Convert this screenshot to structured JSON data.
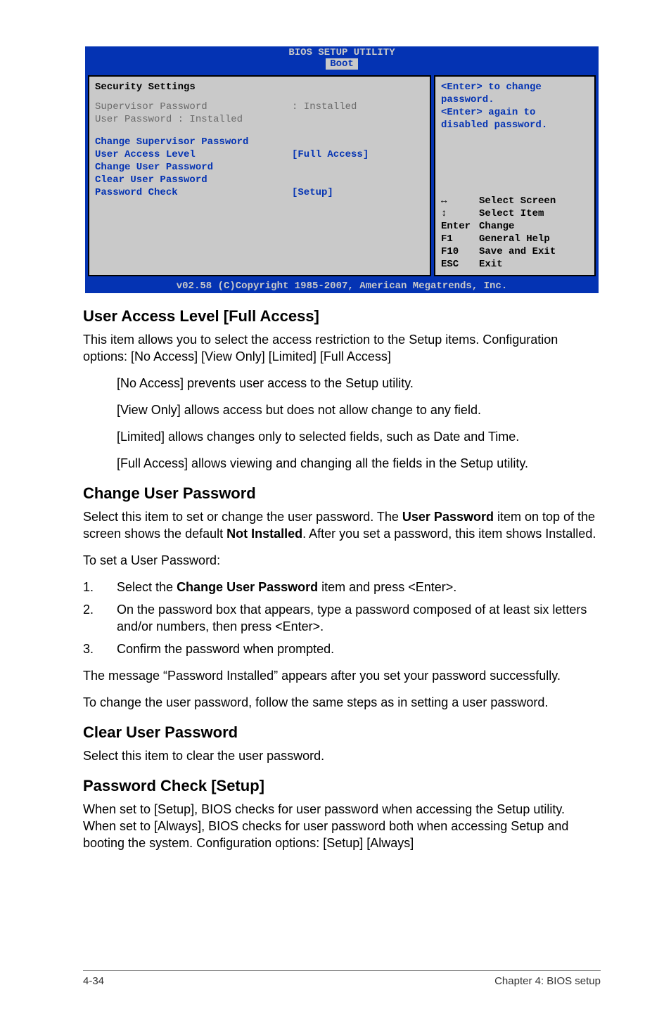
{
  "bios": {
    "title": "BIOS SETUP UTILITY",
    "tab": "Boot",
    "footerbar": "v02.58 (C)Copyright 1985-2007, American Megatrends, Inc.",
    "left": {
      "heading": "Security Settings",
      "r1_label": "Supervisor Password ",
      "r1_value": ": Installed",
      "r2_label": "User Password",
      "r2_value": "       : Installed",
      "opt1": "Change Supervisor Password",
      "opt2_label": "User Access Level",
      "opt2_value": "[Full Access]",
      "opt3": "Change User Password",
      "opt4": "Clear User Password",
      "opt5_label": "Password Check",
      "opt5_value": "[Setup]"
    },
    "right": {
      "help1": "<Enter> to change password.",
      "help2": "<Enter> again to disabled password.",
      "nav1_label": "Select Screen",
      "nav2_label": "Select Item",
      "nav3_key": "Enter",
      "nav3_label": "Change",
      "nav4_key": "F1",
      "nav4_label": "General Help",
      "nav5_key": "F10",
      "nav5_label": "Save and Exit",
      "nav6_key": "ESC",
      "nav6_label": "Exit"
    }
  },
  "doc": {
    "h_ual": "User Access Level [Full Access]",
    "p_ual_1": "This item allows you to select the access restriction to the Setup items. Configuration options: [No Access] [View Only] [Limited] [Full Access]",
    "p_ual_na": "[No Access] prevents user access to the Setup utility.",
    "p_ual_vo": "[View Only] allows access but does not allow change to any field.",
    "p_ual_li": "[Limited] allows changes only to selected fields, such as Date and Time.",
    "p_ual_fa": "[Full Access] allows viewing and changing all the fields in the Setup utility.",
    "h_cup": "Change User Password",
    "p_cup_1a": "Select this item to set or change the user password. The ",
    "p_cup_1b": "User Password",
    "p_cup_1c": " item on top of the screen shows the default ",
    "p_cup_1d": "Not Installed",
    "p_cup_1e": ". After you set a password, this item shows Installed.",
    "p_cup_2": "To set a User Password:",
    "li1a": "Select the ",
    "li1b": "Change User Password",
    "li1c": " item and press <Enter>.",
    "li2": "On the password box that appears, type a password composed of at least six letters and/or numbers, then press <Enter>.",
    "li3": "Confirm the password when prompted.",
    "p_cup_3": "The message “Password Installed” appears after you set your password successfully.",
    "p_cup_4": "To change the user password, follow the same steps as in setting a user password.",
    "h_clp": "Clear User Password",
    "p_clp": "Select this item to clear the user password.",
    "h_pc": "Password Check [Setup]",
    "p_pc": "When set to [Setup], BIOS checks for user password when accessing the Setup utility. When set to [Always], BIOS checks for user password both when accessing Setup and booting the system. Configuration options: [Setup] [Always]"
  },
  "footer": {
    "left": "4-34",
    "right": "Chapter 4: BIOS setup"
  }
}
